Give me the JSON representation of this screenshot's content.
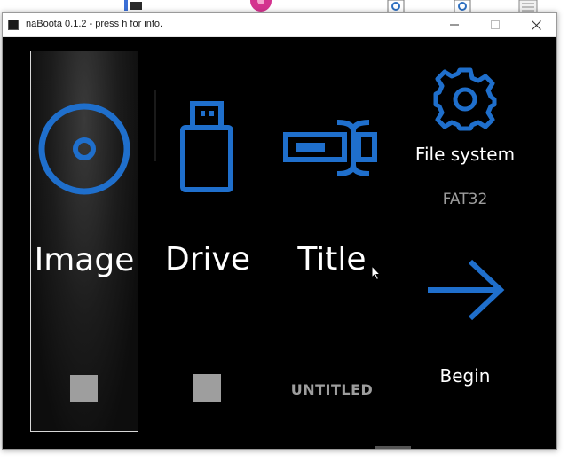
{
  "window": {
    "title": "naBoota 0.1.2 - press h for info."
  },
  "colors": {
    "accent": "#1f6fcc",
    "background": "#000000",
    "text": "#ffffff",
    "muted": "#9e9e9e"
  },
  "tiles": {
    "image": {
      "label": "Image",
      "icon": "disc-icon"
    },
    "drive": {
      "label": "Drive",
      "icon": "usb-drive-icon"
    },
    "title": {
      "label": "Title",
      "icon": "rename-field-icon",
      "value": "UNTITLED"
    }
  },
  "file_system": {
    "label": "File system",
    "value": "FAT32",
    "icon": "gear-icon"
  },
  "begin": {
    "label": "Begin",
    "icon": "arrow-right-icon"
  }
}
